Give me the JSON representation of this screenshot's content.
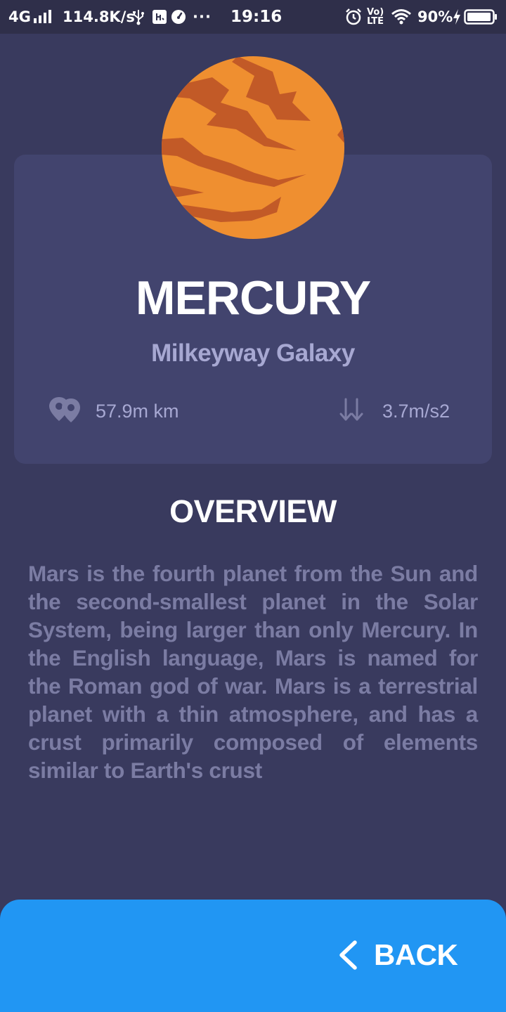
{
  "status_bar": {
    "network": "4G",
    "speed": "114.8K/s",
    "more": "···",
    "time": "19:16",
    "volte_top": "Vo)",
    "volte_bottom": "LTE",
    "battery_percent": "90%"
  },
  "planet": {
    "name": "MERCURY",
    "galaxy": "Milkeyway Galaxy",
    "distance": "57.9m km",
    "gravity": "3.7m/s2",
    "colors": {
      "body": "#ef8f30",
      "stripes": "#c25a27"
    }
  },
  "overview": {
    "title": "OVERVIEW",
    "text": "Mars is the fourth planet from the Sun and the second-smallest planet in the Solar System, being larger than only Mercury. In the English language, Mars is named for the Roman god of war. Mars is a terrestrial planet with a thin atmosphere, and has a crust primarily composed of elements similar to Earth's crust"
  },
  "back_button": {
    "label": "BACK",
    "color": "#2196f3"
  },
  "icons": {
    "distance": "location-pins-icon",
    "gravity": "arrows-up-down-icon",
    "back": "chevron-left-icon"
  }
}
